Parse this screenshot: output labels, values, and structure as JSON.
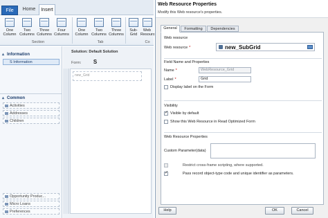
{
  "ribbon": {
    "tabs": [
      "File",
      "Home",
      "Insert"
    ],
    "buttons": [
      {
        "label": "One Column"
      },
      {
        "label": "Two Columns"
      },
      {
        "label": "Three Columns"
      },
      {
        "label": "Four Columns"
      },
      {
        "label": "One Column"
      },
      {
        "label": "Two Columns"
      },
      {
        "label": "Three Columns"
      },
      {
        "label": "Sub-Grid"
      },
      {
        "label": "Web Resource"
      }
    ],
    "groups": [
      "Section",
      "Tab",
      "Co"
    ]
  },
  "leftnav": {
    "information_header": "Information",
    "information_item": "S Information",
    "common_header": "Common",
    "common_items": [
      "Activities",
      "Addresses",
      "Children"
    ],
    "bottom_items": [
      "Opportunity Produc...",
      "Micro Loans",
      "Preferences"
    ]
  },
  "editor": {
    "title": "Solution: Default Solution",
    "form_label": "Form:",
    "form_value": "S",
    "subgrid_placeholder": "new_Grid"
  },
  "dialog": {
    "title": "Web Resource Properties",
    "subtitle": "Modify this Web resource's properties.",
    "tabs": [
      "General",
      "Formatting",
      "Dependencies"
    ],
    "web_resource_section": "Web resource",
    "web_resource_label": "Web resource",
    "web_resource_value": "new_SubGrid",
    "field_section": "Field Name and Properties",
    "name_label": "Name",
    "name_value": "WebResource_Grid",
    "label_label": "Label",
    "label_value": "Grid",
    "display_label_text": "Display label on the Form",
    "visibility_section": "Visibility",
    "visible_default_text": "Visible by default",
    "show_read_optimized_text": "Show this Web Resource in Read Optimized Form",
    "wr_props_section": "Web Resource Properties",
    "custom_param_label": "Custom Parameter(data)",
    "restrict_xss_text": "Restrict cross-frame scripting, where supported.",
    "pass_record_text": "Pass record object-type code and unique identifier as parameters.",
    "help_label": "Help",
    "ok_label": "OK",
    "cancel_label": "Cancel",
    "checks": {
      "display_label": false,
      "visible_default": true,
      "show_read_optimized": false,
      "restrict_xss": false,
      "pass_record": true
    }
  }
}
